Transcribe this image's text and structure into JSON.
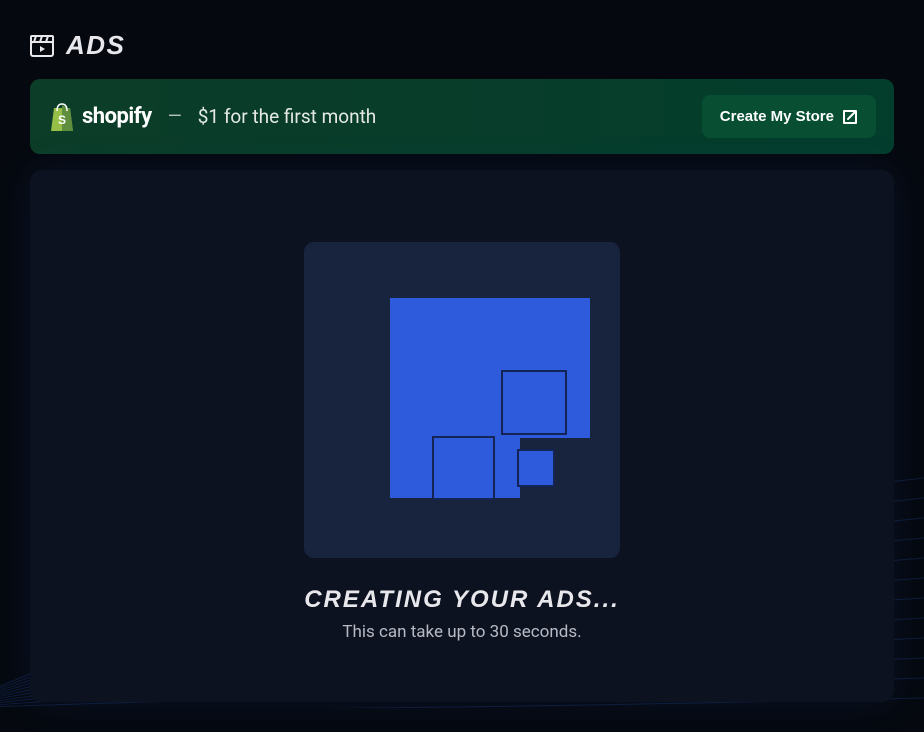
{
  "header": {
    "title": "Ads"
  },
  "promo": {
    "brand": "shopify",
    "separator": "—",
    "offer": "$1 for the first month",
    "cta": "Create My Store"
  },
  "loading": {
    "title": "Creating your ads...",
    "subtitle": "This can take up to 30 seconds."
  }
}
